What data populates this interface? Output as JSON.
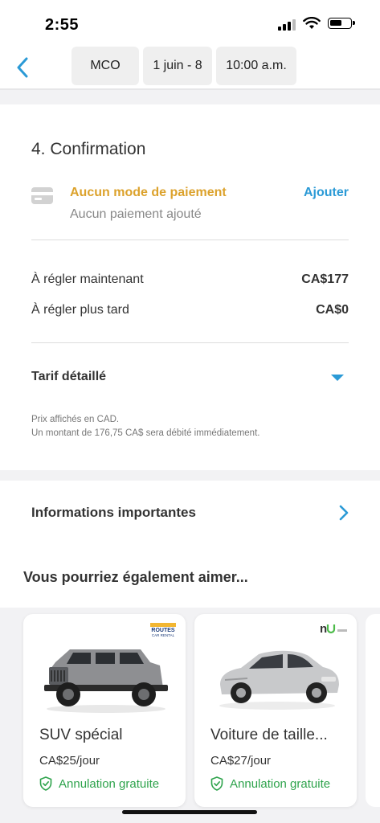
{
  "status_bar": {
    "time": "2:55",
    "icons": [
      "signal-icon",
      "wifi-icon",
      "battery-icon"
    ]
  },
  "header": {
    "back_icon": "chevron-left-icon",
    "pickup_location": "MCO",
    "dates": "1 juin - 8",
    "time": "10:00 a.m."
  },
  "confirmation": {
    "title": "4. Confirmation",
    "payment": {
      "icon": "credit-card-icon",
      "title": "Aucun mode de paiement",
      "subtitle": "Aucun paiement ajouté",
      "add_label": "Ajouter"
    },
    "pay_now_label": "À régler maintenant",
    "pay_now_value": "CA$177",
    "pay_later_label": "À régler plus tard",
    "pay_later_value": "CA$0",
    "details_label": "Tarif détaillé",
    "note_currency": "Prix affichés en CAD.",
    "note_charge": "Un montant de 176,75 CA$ sera débité immédiatement."
  },
  "important_info": {
    "label": "Informations importantes",
    "icon": "chevron-right-icon"
  },
  "recommendations": {
    "title": "Vous pourriez également aimer...",
    "cards": [
      {
        "name": "SUV spécial",
        "price": "CA$25/jour",
        "cancel": "Annulation gratuite",
        "vendor_logo": "Routes Car Rental",
        "image": "jeep-suv-image"
      },
      {
        "name": "Voiture de taille...",
        "price": "CA$27/jour",
        "cancel": "Annulation gratuite",
        "vendor_logo": "nü",
        "image": "sedan-image"
      }
    ]
  },
  "colors": {
    "accent_blue": "#2b9ad6",
    "warning_orange": "#dca22c",
    "success_green": "#2ea34c"
  }
}
